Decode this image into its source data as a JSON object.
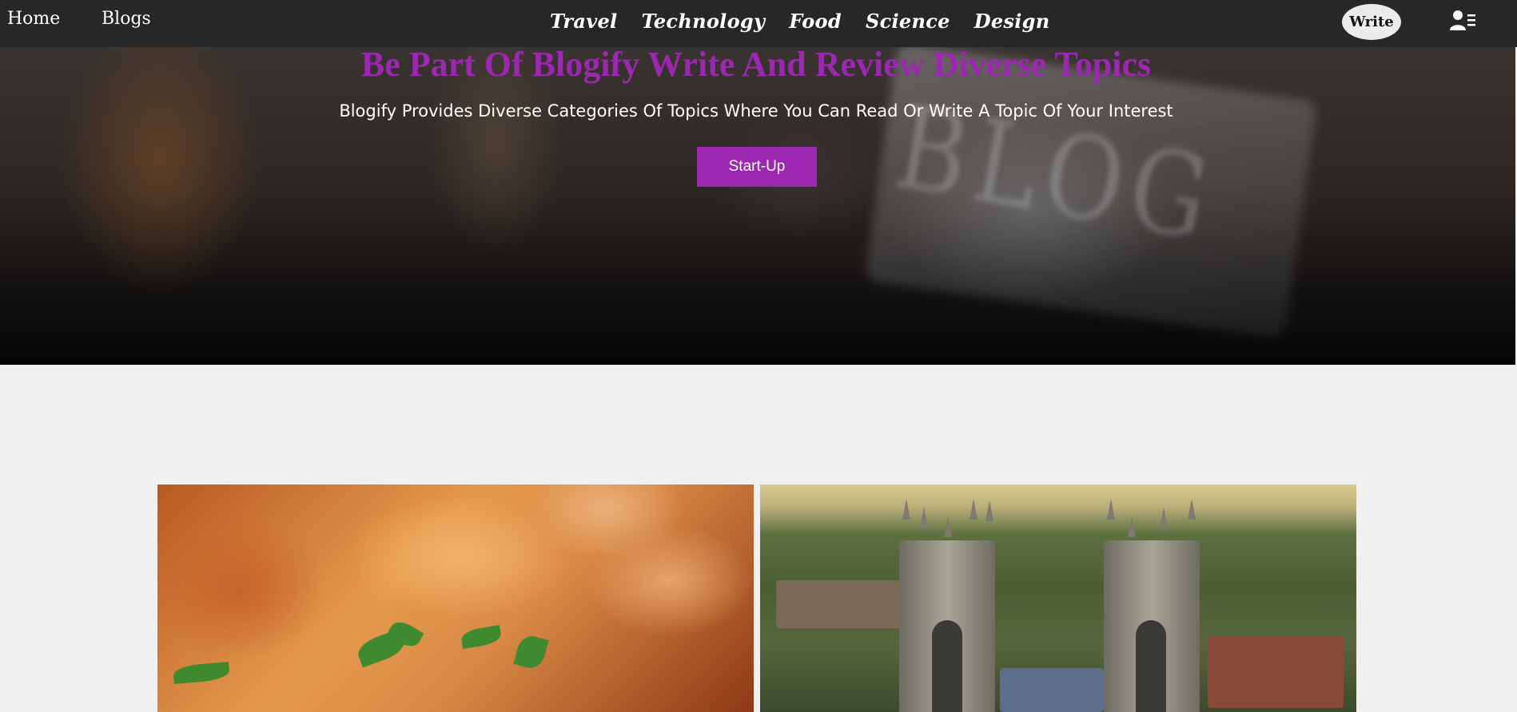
{
  "nav": {
    "home": "Home",
    "blogs": "Blogs",
    "categories": [
      "Travel",
      "Technology",
      "Food",
      "Science",
      "Design"
    ],
    "write": "Write",
    "user_icon": "user-list-icon"
  },
  "hero": {
    "title": "Be Part Of Blogify Write And Review Diverse Topics",
    "subtitle": "Blogify Provides Diverse Categories Of Topics Where You Can Read Or Write A Topic Of Your Interest",
    "cta": "Start-Up",
    "background_word": "BLOG"
  },
  "colors": {
    "accent": "#9c27b0",
    "navbar": "#272727",
    "page_bg": "#f0f0f0"
  },
  "cards": [
    {
      "image": "food-photo"
    },
    {
      "image": "city-cathedral-photo"
    }
  ]
}
